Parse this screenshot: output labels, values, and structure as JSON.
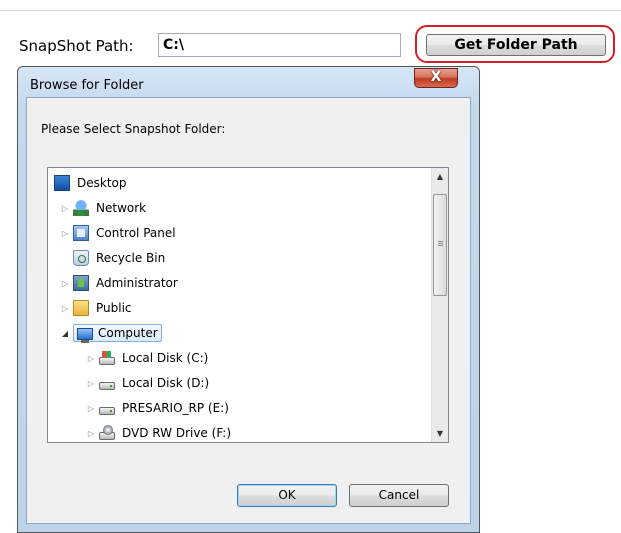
{
  "snapshot": {
    "label": "SnapShot Path:",
    "value": "C:\\",
    "button_label": "Get Folder Path"
  },
  "dialog": {
    "title": "Browse for Folder",
    "close_glyph": "X",
    "prompt": "Please Select Snapshot Folder:",
    "tree": [
      {
        "label": "Desktop",
        "icon": "desktop-icon"
      },
      {
        "label": "Network",
        "icon": "network-icon"
      },
      {
        "label": "Control Panel",
        "icon": "control-panel-icon"
      },
      {
        "label": "Recycle Bin",
        "icon": "recycle-bin-icon"
      },
      {
        "label": "Administrator",
        "icon": "user-folder-icon"
      },
      {
        "label": "Public",
        "icon": "folder-icon"
      },
      {
        "label": "Computer",
        "icon": "computer-icon",
        "selected": true
      },
      {
        "label": "Local Disk (C:)",
        "icon": "windows-drive-icon"
      },
      {
        "label": "Local Disk (D:)",
        "icon": "drive-icon"
      },
      {
        "label": "PRESARIO_RP (E:)",
        "icon": "drive-icon"
      },
      {
        "label": "DVD RW Drive (F:)",
        "icon": "dvd-drive-icon"
      }
    ],
    "ok_label": "OK",
    "cancel_label": "Cancel"
  },
  "colors": {
    "highlight_ring": "#d6202a",
    "selection": "#d9ebfb"
  }
}
